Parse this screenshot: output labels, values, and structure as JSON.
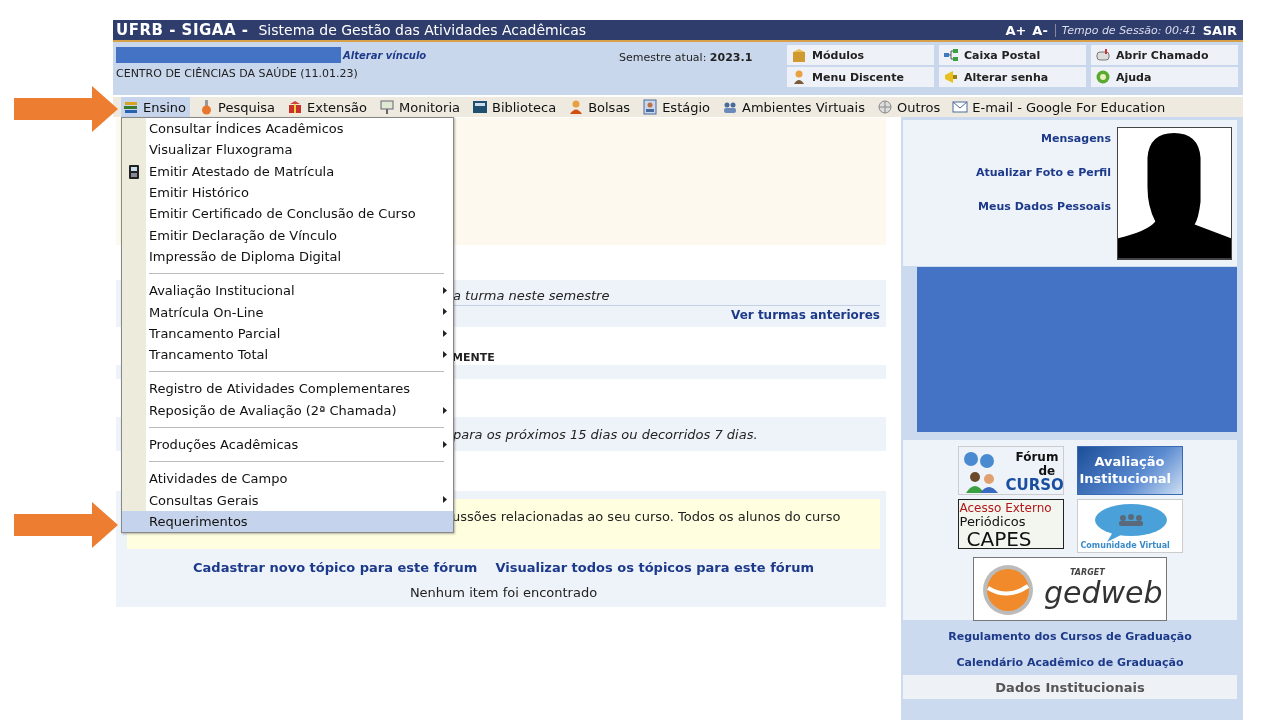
{
  "header": {
    "system": "UFRB - SIGAA -",
    "title": "Sistema de Gestão das Atividades Acadêmicas",
    "font_up": "A+",
    "font_down": "A-",
    "session": "Tempo de Sessão: 00:41",
    "logout": "SAIR"
  },
  "user_bar": {
    "change_link": "Alterar vínculo",
    "unit": "CENTRO DE CIÊNCIAS DA SAÚDE (11.01.23)",
    "semester_label": "Semestre atual:",
    "semester": "2023.1",
    "shortcuts": [
      {
        "label": "Módulos"
      },
      {
        "label": "Caixa Postal"
      },
      {
        "label": "Abrir Chamado"
      },
      {
        "label": "Menu Discente"
      },
      {
        "label": "Alterar senha"
      },
      {
        "label": "Ajuda"
      }
    ]
  },
  "menu": [
    {
      "label": "Ensino",
      "selected": true
    },
    {
      "label": "Pesquisa",
      "selected": false
    },
    {
      "label": "Extensão",
      "selected": false
    },
    {
      "label": "Monitoria",
      "selected": false
    },
    {
      "label": "Biblioteca",
      "selected": false
    },
    {
      "label": "Bolsas",
      "selected": false
    },
    {
      "label": "Estágio",
      "selected": false
    },
    {
      "label": "Ambientes Virtuais",
      "selected": false
    },
    {
      "label": "Outros",
      "selected": false
    },
    {
      "label": "E-mail - Google For Education",
      "selected": false
    }
  ],
  "dropdown": [
    {
      "kind": "item",
      "label": "Consultar Índices Acadêmicos",
      "submenu": false,
      "selected": false
    },
    {
      "kind": "item",
      "label": "Visualizar Fluxograma",
      "submenu": false,
      "selected": false
    },
    {
      "kind": "icon-item",
      "label": "Emitir Atestado de Matrícula",
      "submenu": false,
      "selected": false
    },
    {
      "kind": "item",
      "label": "Emitir Histórico",
      "submenu": false,
      "selected": false
    },
    {
      "kind": "item",
      "label": "Emitir Certificado de Conclusão de Curso",
      "submenu": false,
      "selected": false
    },
    {
      "kind": "item",
      "label": "Emitir Declaração de Vínculo",
      "submenu": false,
      "selected": false
    },
    {
      "kind": "item",
      "label": "Impressão de Diploma Digital",
      "submenu": false,
      "selected": false
    },
    {
      "kind": "separator"
    },
    {
      "kind": "item",
      "label": "Avaliação Institucional",
      "submenu": true,
      "selected": false
    },
    {
      "kind": "item",
      "label": "Matrícula On-Line",
      "submenu": true,
      "selected": false
    },
    {
      "kind": "item",
      "label": "Trancamento Parcial",
      "submenu": true,
      "selected": false
    },
    {
      "kind": "item",
      "label": "Trancamento Total",
      "submenu": true,
      "selected": false
    },
    {
      "kind": "separator"
    },
    {
      "kind": "item",
      "label": "Registro de Atividades Complementares",
      "submenu": false,
      "selected": false
    },
    {
      "kind": "item",
      "label": "Reposição de Avaliação (2ª Chamada)",
      "submenu": true,
      "selected": false
    },
    {
      "kind": "separator"
    },
    {
      "kind": "item",
      "label": "Produções Acadêmicas",
      "submenu": true,
      "selected": false
    },
    {
      "kind": "separator"
    },
    {
      "kind": "item",
      "label": "Atividades de Campo",
      "submenu": false,
      "selected": false
    },
    {
      "kind": "item",
      "label": "Consultas Gerais",
      "submenu": true,
      "selected": false
    },
    {
      "kind": "item",
      "label": "Requerimentos",
      "submenu": false,
      "selected": true
    }
  ],
  "classes": {
    "message": "a turma neste semestre",
    "link": "Ver turmas anteriores"
  },
  "activities": {
    "heading": "MENTE"
  },
  "deadlines": {
    "message": "para os próximos 15 dias ou decorridos 7 dias."
  },
  "forum": {
    "description": "ussões relacionadas ao seu curso. Todos os alunos do curso",
    "links": [
      "Cadastrar novo tópico para este fórum",
      "Visualizar todos os tópicos para este fórum"
    ],
    "empty": "Nenhum item foi encontrado"
  },
  "sidebar": {
    "links": [
      "Mensagens",
      "Atualizar Foto e Perfil",
      "Meus Dados Pessoais"
    ],
    "banners": [
      {
        "kind": "forum",
        "lines": [
          "Fórum",
          "de",
          "CURSO"
        ]
      },
      {
        "kind": "evaluation",
        "lines": [
          "Avaliação",
          "Institucional"
        ]
      },
      {
        "kind": "capes",
        "lines": [
          "Acesso Externo",
          "Periódicos",
          "CAPES"
        ]
      },
      {
        "kind": "community",
        "lines": [
          "Comunidade Virtual"
        ]
      },
      {
        "kind": "gedweb",
        "lines": [
          "TARGET",
          "gedweb"
        ]
      }
    ],
    "footer_links": [
      "Regulamento dos Cursos de Graduação",
      "Calendário Acadêmico de Graduação"
    ],
    "section_title": "Dados Institucionais"
  }
}
